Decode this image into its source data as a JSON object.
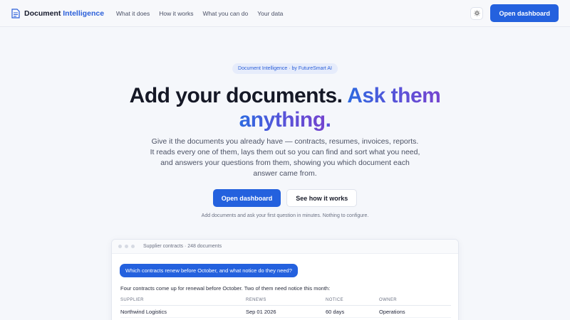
{
  "nav": {
    "brand_main": "Document",
    "brand_accent": "Intelligence",
    "links": [
      "What it does",
      "How it works",
      "What you can do",
      "Your data"
    ],
    "theme_icon": "sun-icon",
    "cta": "Open dashboard"
  },
  "hero": {
    "badge": "Document Intelligence · by FutureSmart AI",
    "headline_plain": "Add your documents.",
    "headline_accent_1": "Ask them",
    "headline_accent_2": "anything",
    "headline_period": ".",
    "subtitle": "Give it the documents you already have — contracts, resumes, invoices, reports. It reads every one of them, lays them out so you can find and sort what you need, and answers your questions from them, showing you which document each answer came from.",
    "primary_cta": "Open dashboard",
    "secondary_cta": "See how it works",
    "note": "Add documents and ask your first question in minutes. Nothing to configure."
  },
  "preview": {
    "title": "Supplier contracts · 248 documents",
    "question": "Which contracts renew before October, and what notice do they need?",
    "answer": "Four contracts come up for renewal before October. Two of them need notice this month:",
    "columns": [
      "SUPPLIER",
      "RENEWS",
      "NOTICE",
      "OWNER"
    ],
    "rows": [
      [
        "Northwind Logistics",
        "Sep 01 2026",
        "60 days",
        "Operations"
      ]
    ]
  },
  "colors": {
    "accent": "#2461de",
    "gradient_start": "#2d6ae0",
    "gradient_end": "#7444cf"
  }
}
